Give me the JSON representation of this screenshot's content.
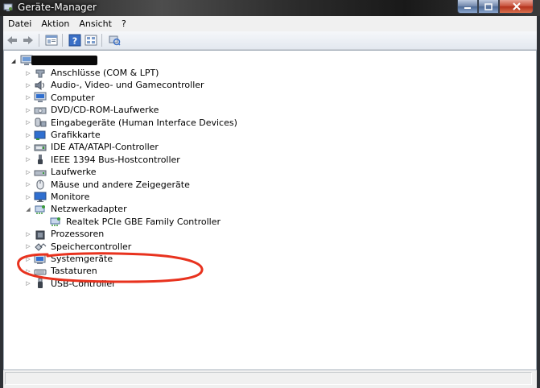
{
  "window": {
    "title": "Geräte-Manager"
  },
  "menubar": {
    "items": [
      "Datei",
      "Aktion",
      "Ansicht",
      "?"
    ]
  },
  "toolbar": {
    "buttons": [
      "back-icon",
      "forward-icon",
      "properties-icon",
      "help-icon",
      "view-icon",
      "scan-hardware-icon"
    ]
  },
  "tree": {
    "root_label": "",
    "categories": [
      {
        "label": "Anschlüsse (COM & LPT)",
        "icon": "port-icon",
        "expanded": false
      },
      {
        "label": "Audio-, Video- und Gamecontroller",
        "icon": "speaker-icon",
        "expanded": false
      },
      {
        "label": "Computer",
        "icon": "computer-icon",
        "expanded": false
      },
      {
        "label": "DVD/CD-ROM-Laufwerke",
        "icon": "disc-drive-icon",
        "expanded": false
      },
      {
        "label": "Eingabegeräte (Human Interface Devices)",
        "icon": "hid-icon",
        "expanded": false
      },
      {
        "label": "Grafikkarte",
        "icon": "display-adapter-icon",
        "expanded": false
      },
      {
        "label": "IDE ATA/ATAPI-Controller",
        "icon": "ide-controller-icon",
        "expanded": false
      },
      {
        "label": "IEEE 1394 Bus-Hostcontroller",
        "icon": "ieee1394-icon",
        "expanded": false
      },
      {
        "label": "Laufwerke",
        "icon": "disk-drive-icon",
        "expanded": false
      },
      {
        "label": "Mäuse und andere Zeigegeräte",
        "icon": "mouse-icon",
        "expanded": false
      },
      {
        "label": "Monitore",
        "icon": "monitor-icon",
        "expanded": false
      },
      {
        "label": "Netzwerkadapter",
        "icon": "network-adapter-icon",
        "expanded": true,
        "children": [
          {
            "label": "Realtek PCIe GBE Family Controller",
            "icon": "network-adapter-icon"
          }
        ]
      },
      {
        "label": "Prozessoren",
        "icon": "processor-icon",
        "expanded": false
      },
      {
        "label": "Speichercontroller",
        "icon": "storage-controller-icon",
        "expanded": false
      },
      {
        "label": "Systemgeräte",
        "icon": "system-device-icon",
        "expanded": false
      },
      {
        "label": "Tastaturen",
        "icon": "keyboard-icon",
        "expanded": false
      },
      {
        "label": "USB-Controller",
        "icon": "usb-icon",
        "expanded": false
      }
    ]
  },
  "annotation_color": "#e8321e",
  "statusbar": {
    "text": ""
  }
}
